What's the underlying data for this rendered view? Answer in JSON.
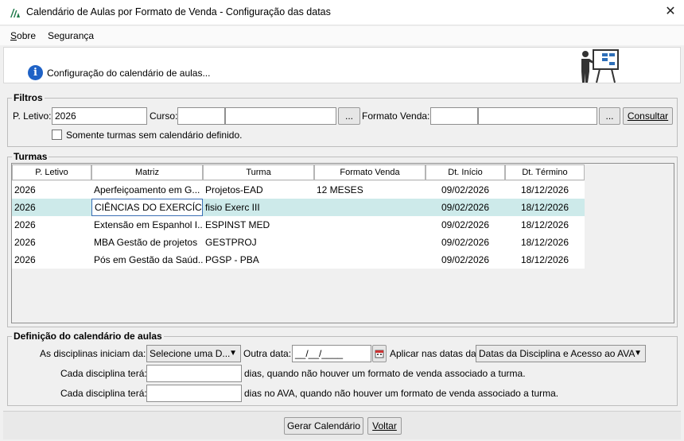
{
  "window": {
    "title": "Calendário de Aulas por Formato de Venda - Configuração das datas",
    "close_glyph": "✕"
  },
  "menu": {
    "sobre_first": "S",
    "sobre_rest": "obre",
    "seguranca": "Segurança"
  },
  "header": {
    "info_glyph": "i",
    "text": "Configuração do calendário de aulas..."
  },
  "filtros": {
    "legend": "Filtros",
    "p_letivo_label": "P. Letivo:",
    "p_letivo_value": "2026",
    "curso_label": "Curso:",
    "curso_code": "",
    "curso_name": "",
    "curso_browse": "...",
    "formato_label": "Formato Venda:",
    "formato_code": "",
    "formato_name": "",
    "formato_browse": "...",
    "consultar": "Consultar",
    "somente_label": "Somente turmas sem calendário definido."
  },
  "turmas": {
    "legend": "Turmas",
    "columns": [
      "P. Letivo",
      "Matriz",
      "Turma",
      "Formato Venda",
      "Dt. Início",
      "Dt. Término"
    ],
    "rows": [
      [
        "2026",
        "Aperfeiçoamento em G...",
        "Projetos-EAD",
        "12 MESES",
        "09/02/2026",
        "18/12/2026"
      ],
      [
        "2026",
        "CIÊNCIAS DO EXERCÍCI...",
        "fisio Exerc III",
        "",
        "09/02/2026",
        "18/12/2026"
      ],
      [
        "2026",
        "Extensão em Espanhol I...",
        "ESPINST MED",
        "",
        "09/02/2026",
        "18/12/2026"
      ],
      [
        "2026",
        "MBA Gestão de projetos",
        "GESTPROJ",
        "",
        "09/02/2026",
        "18/12/2026"
      ],
      [
        "2026",
        "Pós em Gestão da Saúd...",
        "PGSP - PBA",
        "",
        "09/02/2026",
        "18/12/2026"
      ]
    ]
  },
  "definicao": {
    "legend": "Definição do calendário de aulas",
    "iniciam_label": "As disciplinas iniciam da:",
    "iniciam_value": "Selecione uma D...",
    "outra_data_label": "Outra data:",
    "outra_data_value": "__/__/____",
    "aplicar_label": "Aplicar nas datas da:",
    "aplicar_value": "Datas da Disciplina e Acesso ao AVA",
    "cada1_label": "Cada disciplina terá:",
    "cada1_value": "",
    "cada1_suffix": "dias, quando não houver um formato de venda associado a turma.",
    "cada2_label": "Cada disciplina terá:",
    "cada2_value": "",
    "cada2_suffix": "dias no AVA, quando não houver um formato de venda associado a turma."
  },
  "footer": {
    "gerar": "Gerar Calendário",
    "voltar": "Voltar"
  }
}
